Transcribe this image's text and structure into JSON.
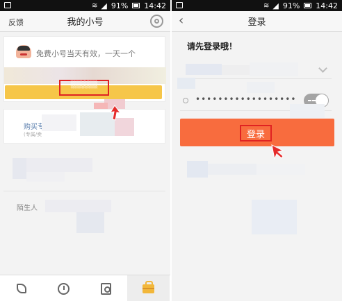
{
  "status": {
    "battery_pct": "91%",
    "time": "14:42"
  },
  "left_screen": {
    "nav": {
      "left_label": "反馈",
      "title": "我的小号"
    },
    "promo_text": "免费小号当天有效，一天一个",
    "buy_label": "购买专属",
    "buy_sub": "(专属/卖",
    "stranger_label": "陌生人",
    "tabs": [
      "phone-icon",
      "clock-icon",
      "contacts-icon",
      "briefcase-icon"
    ]
  },
  "right_screen": {
    "nav": {
      "title": "登录"
    },
    "heading": "请先登录哦！",
    "password_dots": "••••••••••••••••••",
    "login_button_label": "登录"
  },
  "colors": {
    "login_button": "#f86c3e",
    "get_number_button": "#f6c649",
    "highlight_box": "#e02222",
    "status_bar": "#111111"
  }
}
